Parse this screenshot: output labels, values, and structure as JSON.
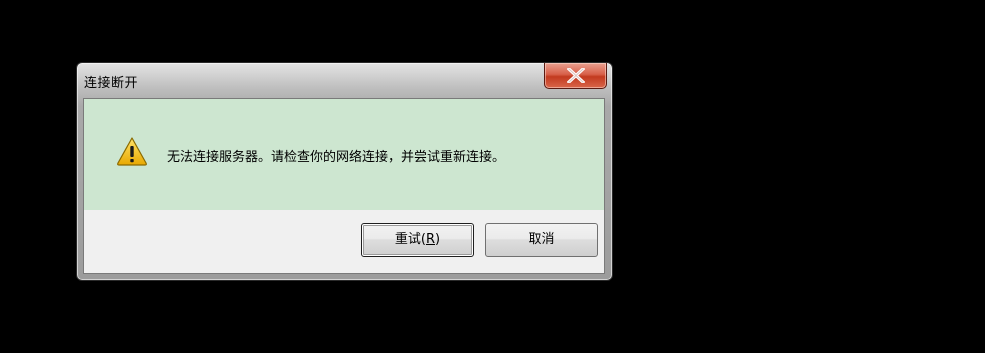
{
  "window": {
    "title": "连接断开"
  },
  "message": {
    "text": "无法连接服务器。请检查你的网络连接，并尝试重新连接。",
    "icon": "warning-icon"
  },
  "buttons": {
    "retry": {
      "label_prefix": "重试(",
      "mnemonic": "R",
      "label_suffix": ")"
    },
    "cancel_label": "取消"
  },
  "colors": {
    "message_background": "#cde6d0",
    "close_button": "#c23a1f"
  }
}
